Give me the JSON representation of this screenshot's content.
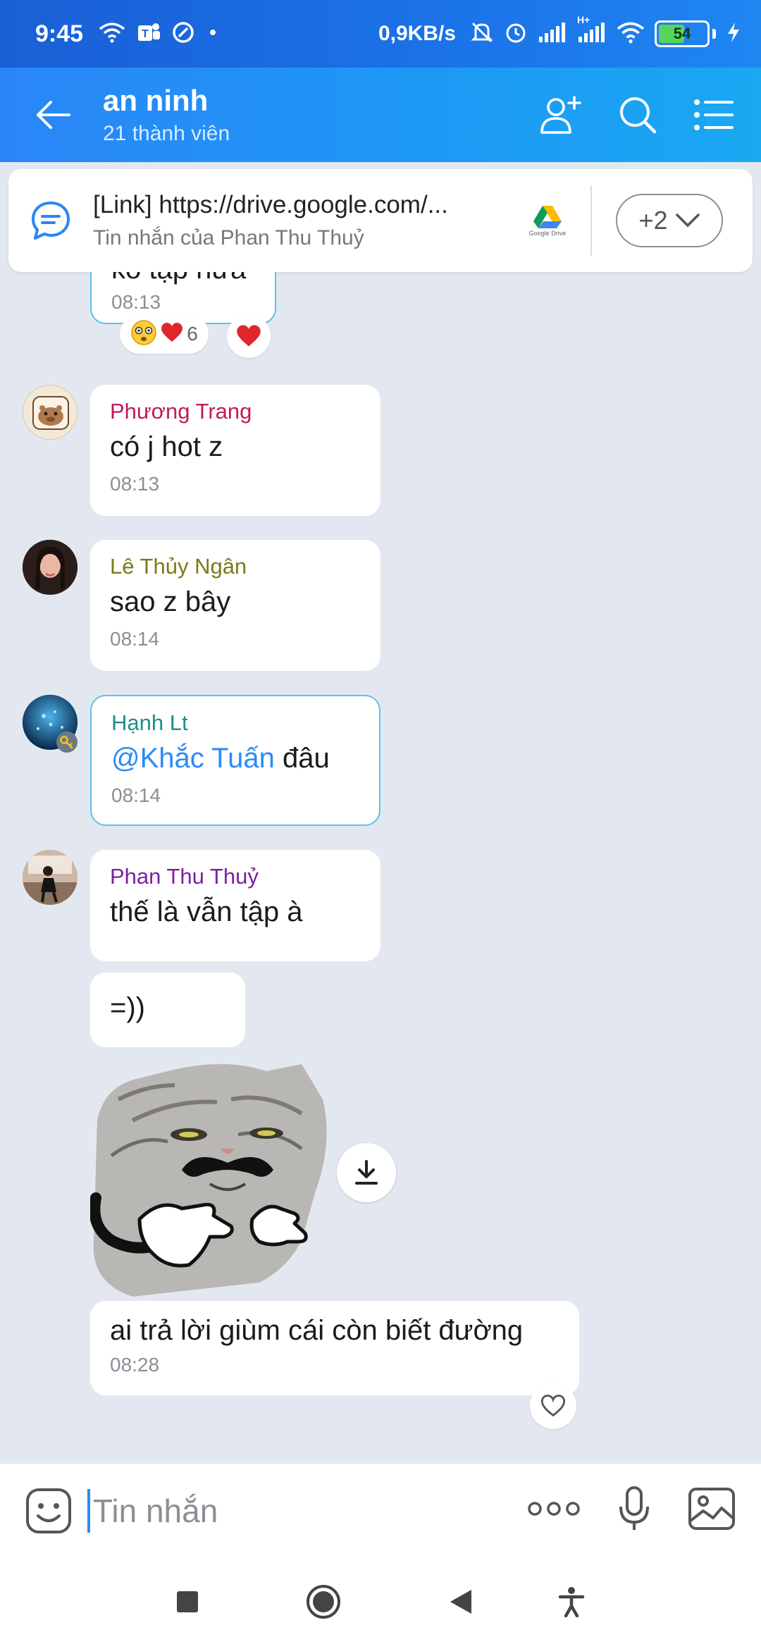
{
  "status_bar": {
    "time": "9:45",
    "net_speed": "0,9KB/s",
    "battery": "54",
    "network_label": "H+",
    "icons": [
      "wifi-icon",
      "teams-icon",
      "sync-icon",
      "dot-icon",
      "mute-icon",
      "alarm-icon",
      "signal-icon",
      "signal-icon",
      "wifi-icon",
      "battery-icon",
      "charging-icon"
    ]
  },
  "header": {
    "title": "an ninh",
    "subtitle": "21 thành viên"
  },
  "pinned": {
    "title": "[Link] https://drive.google.com/...",
    "subtitle": "Tin nhắn của Phan Thu Thuỷ",
    "drive_label": "Google Drive",
    "more_count": "+2"
  },
  "messages": {
    "partial": {
      "text": "ko tập nữa",
      "time": "08:13",
      "reaction_count": "6"
    },
    "m1": {
      "sender": "Phương Trang",
      "sender_color": "#c2185b",
      "text": "có j hot z",
      "time": "08:13"
    },
    "m2": {
      "sender": "Lê Thủy Ngân",
      "sender_color": "#7a7a1a",
      "text": "sao z bây",
      "time": "08:14"
    },
    "m3": {
      "sender": "Hạnh Lt",
      "sender_color": "#1a8f8a",
      "mention": "@Khắc Tuấn",
      "text": " đâu",
      "time": "08:14"
    },
    "m4": {
      "sender": "Phan Thu Thuỷ",
      "sender_color": "#7b1fa2",
      "text": "thế là vẫn tập à"
    },
    "m5": {
      "text": "=))"
    },
    "m6": {
      "text": "ai trả lời giùm cái còn biết đường",
      "time": "08:28"
    }
  },
  "input": {
    "placeholder": "Tin nhắn"
  },
  "colors": {
    "accent": "#1b73e8",
    "mention": "#2b8af7"
  }
}
